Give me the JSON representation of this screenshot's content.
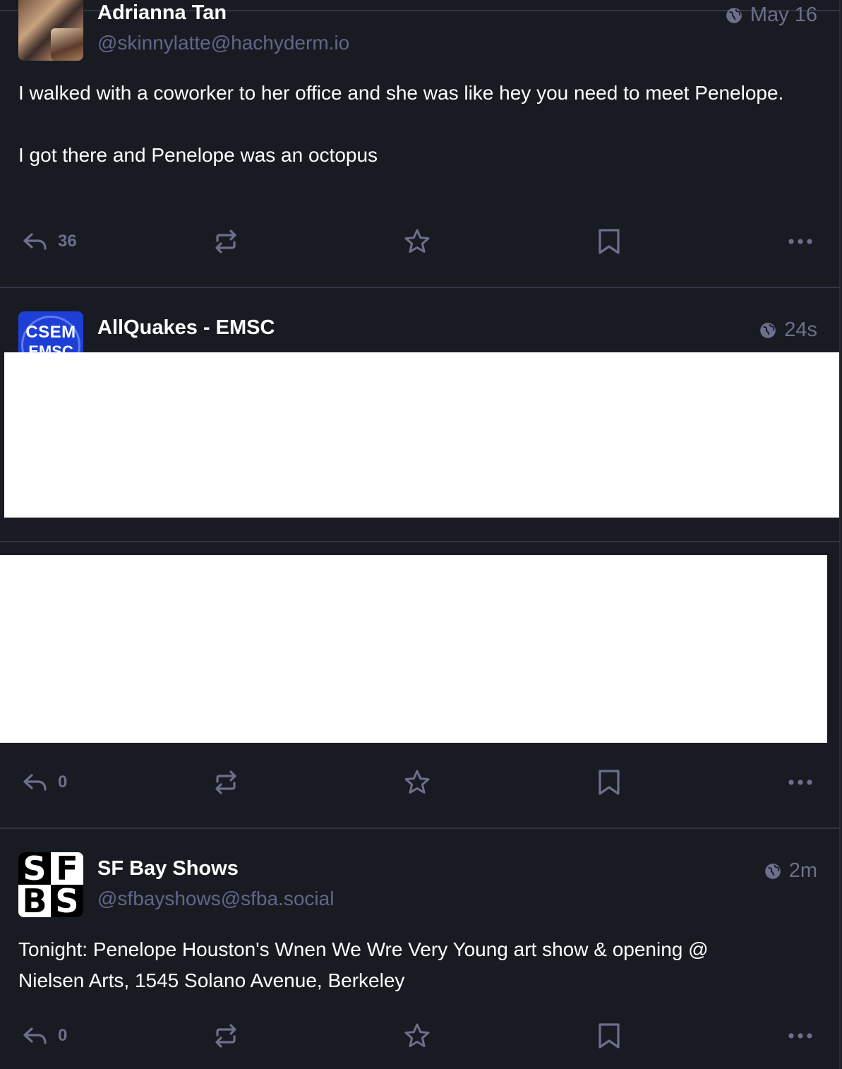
{
  "colors": {
    "background": "#191b22",
    "divider": "#313543",
    "muted": "#6d6f8c",
    "handle": "#787aa8",
    "text": "#ffffff",
    "redaction": "#ffffff"
  },
  "posts": [
    {
      "display_name": "Adrianna Tan",
      "handle": "@skinnylatte@hachyderm.io",
      "timestamp": "May 16",
      "visibility_icon": "globe-icon",
      "content": [
        "I walked with a coworker to her office and she was like hey you need to meet Penelope.",
        "I got there and Penelope was an octopus"
      ],
      "actions": {
        "reply_count": "36"
      }
    },
    {
      "display_name": "AllQuakes - EMSC",
      "avatar_text": [
        "CSEM",
        "EMSC"
      ],
      "timestamp": "24s",
      "visibility_icon": "globe-icon",
      "actions": {
        "reply_count": "0"
      }
    },
    {
      "display_name": "SF Bay Shows",
      "handle": "@sfbayshows@sfba.social",
      "timestamp": "2m",
      "visibility_icon": "globe-icon",
      "avatar_letters": [
        "S",
        "F",
        "B",
        "S"
      ],
      "content": [
        "Tonight: Penelope Houston's Wnen We Wre Very Young art show & opening @ Nielsen Arts, 1545 Solano Avenue, Berkeley"
      ],
      "actions": {
        "reply_count": "0"
      }
    }
  ],
  "action_icons": [
    "reply-icon",
    "boost-icon",
    "favourite-icon",
    "bookmark-icon",
    "more-icon"
  ]
}
